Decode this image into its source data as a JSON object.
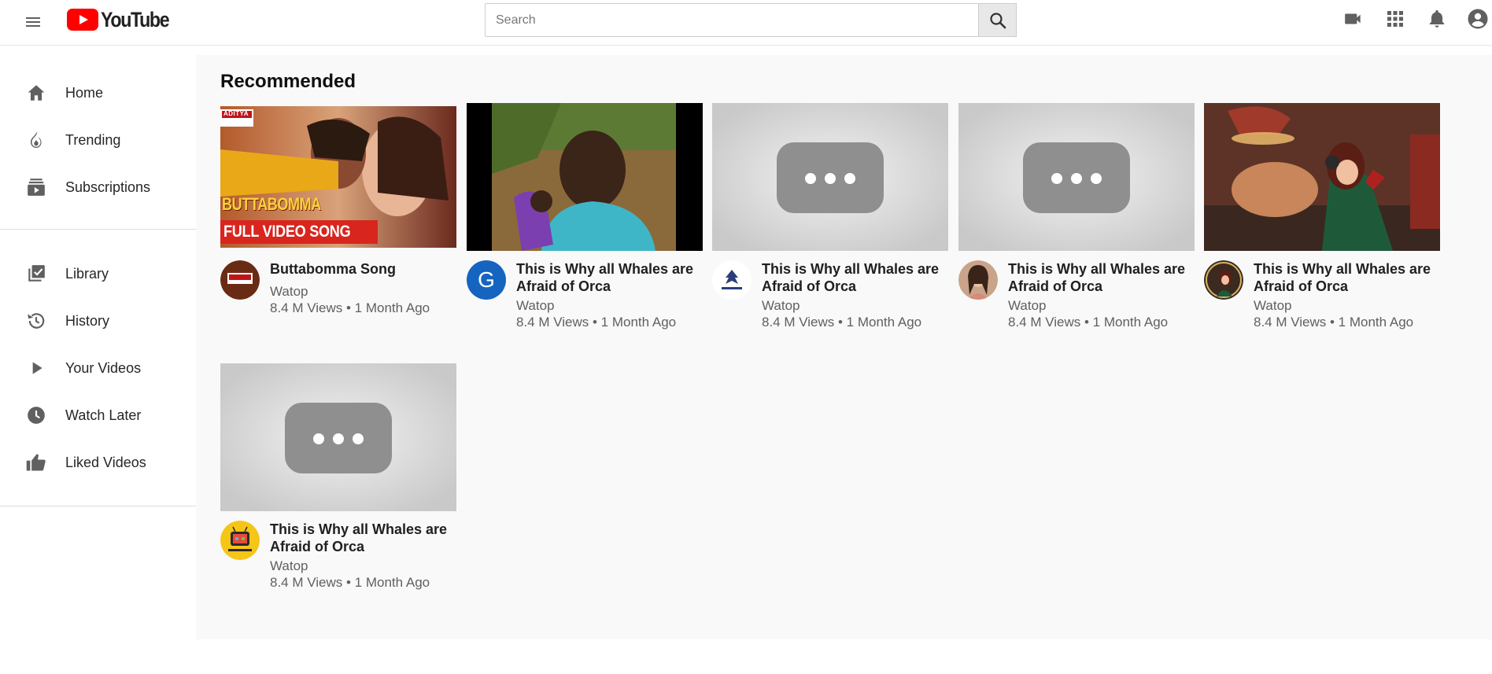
{
  "header": {
    "logo_text": "YouTube",
    "search_placeholder": "Search"
  },
  "sidebar": {
    "primary": [
      {
        "label": "Home",
        "icon": "home-icon"
      },
      {
        "label": "Trending",
        "icon": "flame-icon"
      },
      {
        "label": "Subscriptions",
        "icon": "subscriptions-icon"
      }
    ],
    "secondary": [
      {
        "label": "Library",
        "icon": "library-icon"
      },
      {
        "label": "History",
        "icon": "history-icon"
      },
      {
        "label": "Your Videos",
        "icon": "play-icon"
      },
      {
        "label": "Watch Later",
        "icon": "clock-icon"
      },
      {
        "label": "Liked Videos",
        "icon": "thumbs-up-icon"
      }
    ]
  },
  "main": {
    "title": "Recommended",
    "videos": [
      {
        "title": "Buttabomma Song",
        "channel": "Watop",
        "stats": "8.4 M Views • 1 Month Ago",
        "thumb_text_1": "BUTTABOMMA",
        "thumb_text_2": "FULL VIDEO SONG",
        "thumb_badge": "ADITYA"
      },
      {
        "title": "This is Why all Whales are Afraid of Orca",
        "channel": "Watop",
        "stats": "8.4 M Views • 1 Month Ago",
        "avatar_letter": "G"
      },
      {
        "title": "This is Why all Whales are Afraid of Orca",
        "channel": "Watop",
        "stats": "8.4 M Views • 1 Month Ago"
      },
      {
        "title": "This is Why all Whales are Afraid of Orca",
        "channel": "Watop",
        "stats": "8.4 M Views • 1 Month Ago"
      },
      {
        "title": "This is Why all Whales are Afraid of Orca",
        "channel": "Watop",
        "stats": "8.4 M Views • 1 Month Ago"
      },
      {
        "title": "This is Why all Whales are Afraid of Orca",
        "channel": "Watop",
        "stats": "8.4 M Views • 1 Month Ago"
      }
    ]
  },
  "colors": {
    "brand_red": "#ff0000",
    "main_bg": "#f9f9f9",
    "text_secondary": "#606060"
  }
}
